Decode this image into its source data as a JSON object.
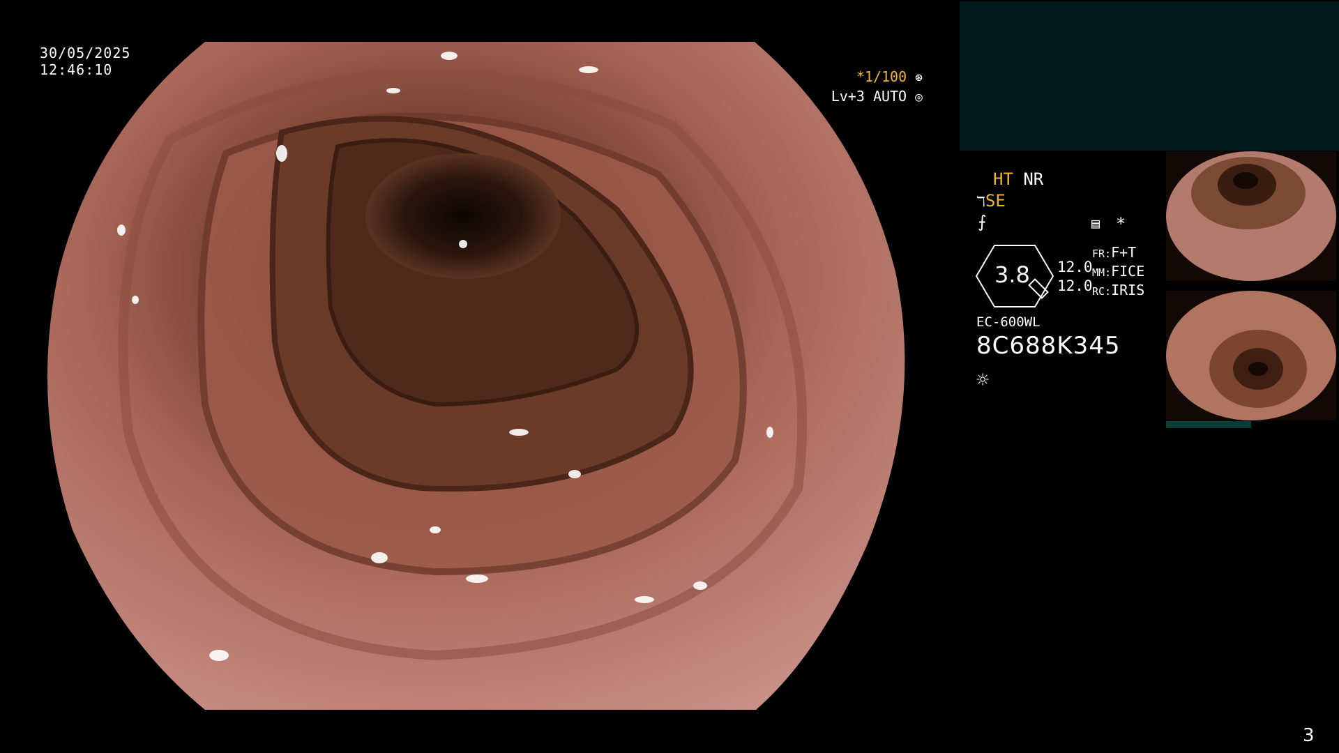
{
  "overlay": {
    "date": "30/05/2025",
    "time": "12:46:10",
    "shutter": "*1/100",
    "level": "Lv+3",
    "mode": "AUTO",
    "page_number": "3"
  },
  "settings": {
    "ht": "HT",
    "nr": "NR",
    "se": "SE",
    "zoom_value": "3.8",
    "val_top": "12.0",
    "val_bottom": "12.0",
    "fr_label": "FR:",
    "fr_value": "F+T",
    "mm_label": "MM:",
    "mm_value": "FICE",
    "rc_label": "RC:",
    "rc_value": "IRIS",
    "asterisk": "*"
  },
  "scope": {
    "model": "EC-600WL",
    "serial": "8C688K345"
  },
  "colors": {
    "accent": "#f2b52a",
    "panel": "#021a1c",
    "tissue": "#b97a70"
  },
  "icons": {
    "shutter": "aperture-icon",
    "iris": "iris-icon",
    "light": "sun-icon",
    "scope": "scope-icon",
    "structure": "structure-enhance-icon",
    "memory": "memory-card-icon"
  }
}
